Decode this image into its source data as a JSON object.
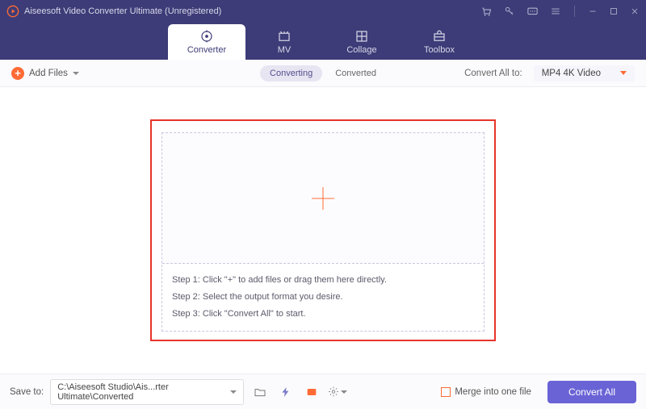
{
  "titlebar": {
    "title": "Aiseesoft Video Converter Ultimate (Unregistered)"
  },
  "tabs": [
    {
      "label": "Converter"
    },
    {
      "label": "MV"
    },
    {
      "label": "Collage"
    },
    {
      "label": "Toolbox"
    }
  ],
  "toolbar": {
    "add_files": "Add Files",
    "status_converting": "Converting",
    "status_converted": "Converted",
    "convert_all_to": "Convert All to:",
    "format": "MP4 4K Video"
  },
  "steps": {
    "s1": "Step 1: Click \"+\" to add files or drag them here directly.",
    "s2": "Step 2: Select the output format you desire.",
    "s3": "Step 3: Click \"Convert All\" to start."
  },
  "footer": {
    "save_to": "Save to:",
    "path": "C:\\Aiseesoft Studio\\Ais...rter Ultimate\\Converted",
    "merge": "Merge into one file",
    "convert_all": "Convert All"
  }
}
